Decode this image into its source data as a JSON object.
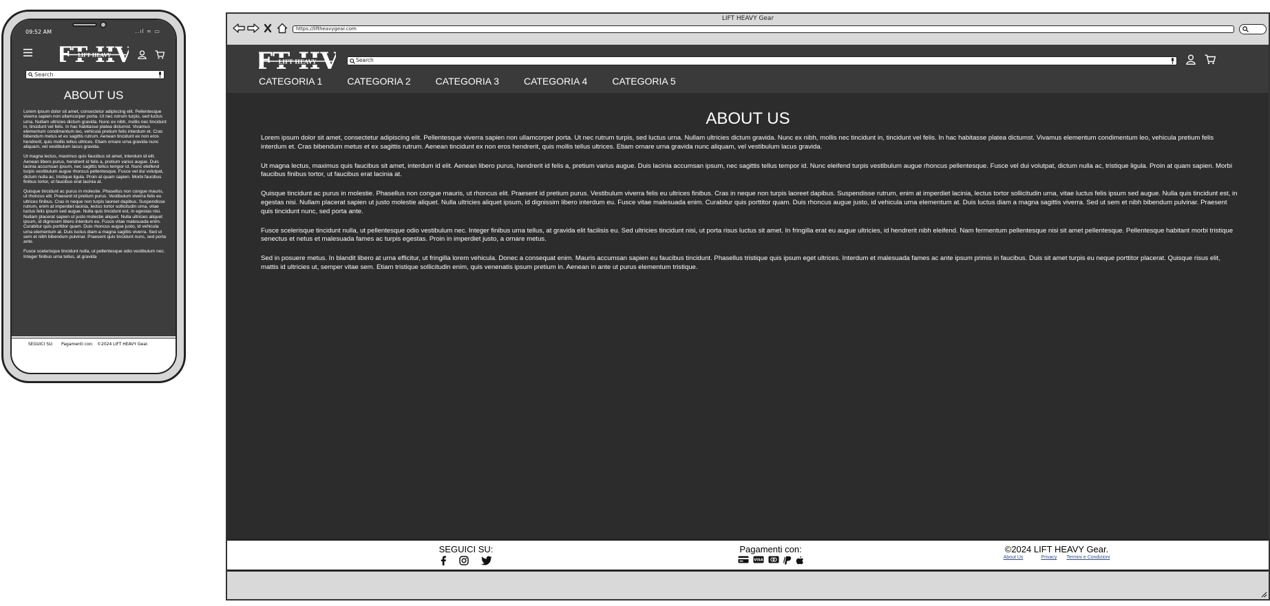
{
  "phone": {
    "time": "09:52 AM",
    "status_icons": "..ıl ≈ ▭",
    "logo_text": "LFT HVY",
    "logo_subtext": "LIFT HEAVY",
    "search_placeholder": "Search",
    "title": "ABOUT US",
    "paragraphs": [
      "Lorem ipsum dolor sit amet, consectetur adipiscing elit. Pellentesque viverra sapien non ullamcorper porta. Ut nec rutrum turpis, sed luctus urna. Nullam ultricies dictum gravida. Nunc ex nibh, mollis nec tincidunt in, tincidunt vel felis. In hac habitasse platea dictumst. Vivamus elementum condimentum leo, vehicula pretium felis interdum et. Cras bibendum metus et ex sagittis rutrum. Aenean tincidunt ex non eros hendrerit, quis mollis tellus ultrices. Etiam ornare urna gravida nunc aliquam, vel vestibulum lacus gravida.",
      "Ut magna lectus, maximus quis faucibus sit amet, interdum id elit. Aenean libero purus, hendrerit id felis a, pretium varius augue. Duis lacinia accumsan ipsum, nec sagittis tellus tempor id. Nunc eleifend turpis vestibulum augue rhoncus pellentesque. Fusce vel dui volutpat, dictum nulla ac, tristique ligula. Proin at quam sapien. Morbi faucibus finibus tortor, ut faucibus erat lacinia at.",
      "Quisque tincidunt ac purus in molestie. Phasellus non congue mauris, ut rhoncus elit. Praesent id pretium purus. Vestibulum viverra felis eu ultrices finibus. Cras in neque non turpis laoreet dapibus. Suspendisse rutrum, enim at imperdiet lacinia, lectus tortor sollicitudin urna, vitae luctus felis ipsum sed augue. Nulla quis tincidunt est, in egestas nisi. Nullam placerat sapien ut justo molestie aliquet. Nulla ultricies aliquet ipsum, id dignissim libero interdum eu. Fusce vitae malesuada enim. Curabitur quis porttitor quam. Duis rhoncus augue justo, id vehicula urna elementum at. Duis luctus diam a magna sagittis viverra. Sed ut sem et nibh bibendum pulvinar. Praesent quis tincidunt nunc, sed porta ante.",
      "Fusce scelerisque tincidunt nulla, ut pellentesque odio vestibulum nec. Integer finibus urna tellus, at gravida"
    ],
    "footer_follow": "SEGUICI SU:",
    "footer_payments": "Pagamenti con:",
    "footer_copyright": "©2024 LIFT HEAVY Gear."
  },
  "browser": {
    "window_title": "LIFT HEAVY Gear",
    "url": "https://liftheavygear.com"
  },
  "site": {
    "logo_text": "LFT HVY",
    "logo_subtext": "LIFT HEAVY",
    "search_placeholder": "Search",
    "nav": [
      "CATEGORIA 1",
      "CATEGORIA 2",
      "CATEGORIA 3",
      "CATEGORIA 4",
      "CATEGORIA 5"
    ],
    "title": "ABOUT US",
    "paragraphs": [
      "Lorem ipsum dolor sit amet, consectetur adipiscing elit. Pellentesque viverra sapien non ullamcorper porta. Ut nec rutrum turpis, sed luctus urna. Nullam ultricies dictum gravida. Nunc ex nibh, mollis nec tincidunt in, tincidunt vel felis. In hac habitasse platea dictumst. Vivamus elementum condimentum leo, vehicula pretium felis interdum et. Cras bibendum metus et ex sagittis rutrum. Aenean tincidunt ex non eros hendrerit, quis mollis tellus ultrices. Etiam ornare urna gravida nunc aliquam, vel vestibulum lacus gravida.",
      "Ut magna lectus, maximus quis faucibus sit amet, interdum id elit. Aenean libero purus, hendrerit id felis a, pretium varius augue. Duis lacinia accumsan ipsum, nec sagittis tellus tempor id. Nunc eleifend turpis vestibulum augue rhoncus pellentesque. Fusce vel dui volutpat, dictum nulla ac, tristique ligula. Proin at quam sapien. Morbi faucibus finibus tortor, ut faucibus erat lacinia at.",
      "Quisque tincidunt ac purus in molestie. Phasellus non congue mauris, ut rhoncus elit. Praesent id pretium purus. Vestibulum viverra felis eu ultrices finibus. Cras in neque non turpis laoreet dapibus. Suspendisse rutrum, enim at imperdiet lacinia, lectus tortor sollicitudin urna, vitae luctus felis ipsum sed augue. Nulla quis tincidunt est, in egestas nisi. Nullam placerat sapien ut justo molestie aliquet. Nulla ultricies aliquet ipsum, id dignissim libero interdum eu. Fusce vitae malesuada enim. Curabitur quis porttitor quam. Duis rhoncus augue justo, id vehicula urna elementum at. Duis luctus diam a magna sagittis viverra. Sed ut sem et nibh bibendum pulvinar. Praesent quis tincidunt nunc, sed porta ante.",
      "Fusce scelerisque tincidunt nulla, ut pellentesque odio vestibulum nec. Integer finibus urna tellus, at gravida elit facilisis eu. Sed ultricies tincidunt nisi, ut porta risus luctus sit amet. In fringilla erat eu augue ultricies, id hendrerit nibh eleifend. Nam fermentum pellentesque nisi sit amet pellentesque. Pellentesque habitant morbi tristique senectus et netus et malesuada fames ac turpis egestas. Proin in imperdiet justo, a ornare metus.",
      "Sed in posuere metus. In blandit libero at urna efficitur, ut fringilla lorem vehicula. Donec a consequat enim. Mauris accumsan sapien eu faucibus tincidunt. Phasellus tristique quis ipsum eget ultrices. Interdum et malesuada fames ac ante ipsum primis in faucibus. Duis sit amet turpis eu neque porttitor placerat. Quisque risus elit, mattis id ultricies ut, semper vitae sem. Etiam tristique sollicitudin enim, quis venenatis ipsum pretium in. Aenean in ante ut purus elementum tristique."
    ],
    "footer": {
      "follow_label": "SEGUICI SU:",
      "social_icons": [
        "facebook-icon",
        "instagram-icon",
        "twitter-icon"
      ],
      "payments_label": "Pagamenti con:",
      "payment_icons": [
        "credit-card-icon",
        "visa-icon",
        "mastercard-icon",
        "paypal-icon",
        "apple-pay-icon"
      ],
      "copyright": "©2024 LIFT HEAVY Gear.",
      "links": [
        "About Us",
        "Privacy",
        "Termini e Condizioni"
      ]
    }
  },
  "colors": {
    "app_background": "#2c2c2c",
    "header_background": "#3a3a3a",
    "link": "#1f4f9b"
  }
}
